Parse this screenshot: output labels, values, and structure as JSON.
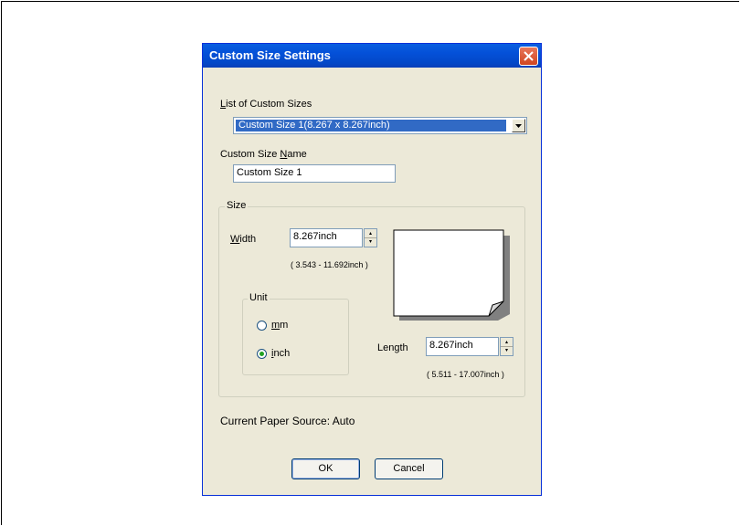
{
  "dialog": {
    "title": "Custom Size Settings"
  },
  "custom_sizes": {
    "label_pre": "",
    "label_ul": "L",
    "label_post": "ist of Custom Sizes",
    "selected": "Custom Size 1(8.267 x 8.267inch)"
  },
  "custom_name": {
    "label_pre": "Custom Size ",
    "label_ul": "N",
    "label_post": "ame",
    "value": "Custom Size 1"
  },
  "size_group": {
    "legend": "Size",
    "width": {
      "label_pre": "",
      "label_ul": "W",
      "label_post": "idth",
      "value": "8.267inch",
      "range": "( 3.543 - 11.692inch )"
    },
    "length": {
      "label_pre": "Len",
      "label_ul": "g",
      "label_post": "th",
      "value": "8.267inch",
      "range": "( 5.511 - 17.007inch )"
    },
    "unit": {
      "legend": "Unit",
      "options": [
        {
          "pre": "",
          "ul": "m",
          "post": "m",
          "selected": false
        },
        {
          "pre": "",
          "ul": "i",
          "post": "nch",
          "selected": true
        }
      ]
    }
  },
  "paper_source": "Current Paper Source: Auto",
  "buttons": {
    "ok": "OK",
    "cancel": "Cancel"
  },
  "colors": {
    "titlebar": "#0450d8",
    "selection": "#316ac5",
    "dialog_bg": "#ece9d8"
  }
}
